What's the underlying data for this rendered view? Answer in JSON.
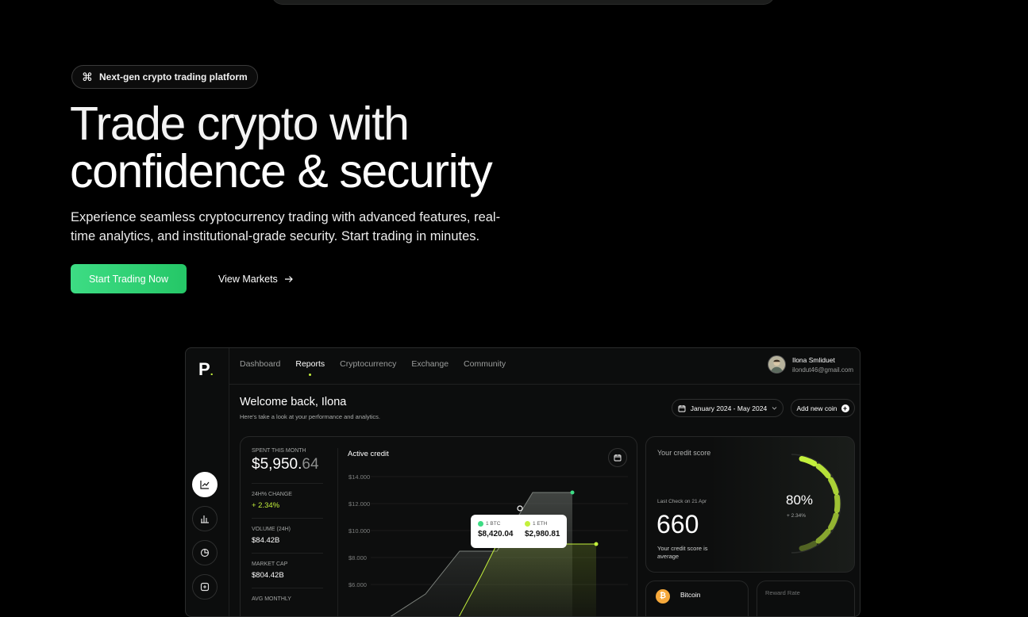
{
  "hero": {
    "badge_icon": "command-icon",
    "badge_text": "Next-gen crypto trading platform",
    "title_line1": "Trade crypto with",
    "title_line2": "confidence & security",
    "subtitle": "Experience seamless cryptocurrency trading with advanced features, real-time analytics, and institutional-grade security. Start trading in minutes.",
    "primary_cta": "Start Trading Now",
    "secondary_cta": "View Markets",
    "secondary_icon": "arrow-right-icon",
    "accent": "#2fd373"
  },
  "dashboard": {
    "logo": "P",
    "nav": [
      "Dashboard",
      "Reports",
      "Cryptocurrency",
      "Exchange",
      "Community"
    ],
    "nav_active": "Reports",
    "user": {
      "name": "Ilona Smliduet",
      "email": "ilondut46@gmail.com"
    },
    "welcome_title": "Welcome back, Ilona",
    "welcome_sub": "Here's take a look at your performance and analytics.",
    "date_range": "January 2024 - May 2024",
    "add_coin": "Add new coin",
    "stats": {
      "spent_label": "SPENT THIS MONTH",
      "spent_main": "$5,950.",
      "spent_cents": "64",
      "change_label": "24H% CHANGE",
      "change_value": "+ 2.34%",
      "volume_label": "VOLUME (24H)",
      "volume_value": "$84.42B",
      "mcap_label": "MARKET CAP",
      "mcap_value": "$804.42B",
      "avg_label": "AVG MONTHLY"
    },
    "chart": {
      "title": "Active credit",
      "yticks": [
        "$14.000",
        "$12.000",
        "$10.000",
        "$8.000",
        "$6.000"
      ],
      "tooltip": {
        "btc_label": "1 BTC",
        "btc_value": "$8,420.04",
        "eth_label": "1 ETH",
        "eth_value": "$2,980.81"
      },
      "btc_color": "#3ddc84",
      "eth_color": "#c3f03c"
    },
    "credit": {
      "title": "Your credit score",
      "last_check": "Last Check on 21 Apr",
      "score": "660",
      "score_sub": "Your credit score is average",
      "percent": "80%",
      "percent_sub": "+ 2.34%",
      "gauge_color": "#c3f03c"
    },
    "coin_card": {
      "name": "Bitcoin",
      "icon": "bitcoin-icon"
    },
    "reward_label": "Reward Rate"
  },
  "chart_data": {
    "type": "area",
    "title": "Active credit",
    "yticks": [
      "$14.000",
      "$12.000",
      "$10.000",
      "$8.000",
      "$6.000"
    ],
    "ylim": [
      6000,
      14000
    ],
    "series": [
      {
        "name": "1 BTC",
        "color": "#3ddc84"
      },
      {
        "name": "1 ETH",
        "color": "#c3f03c"
      }
    ]
  }
}
